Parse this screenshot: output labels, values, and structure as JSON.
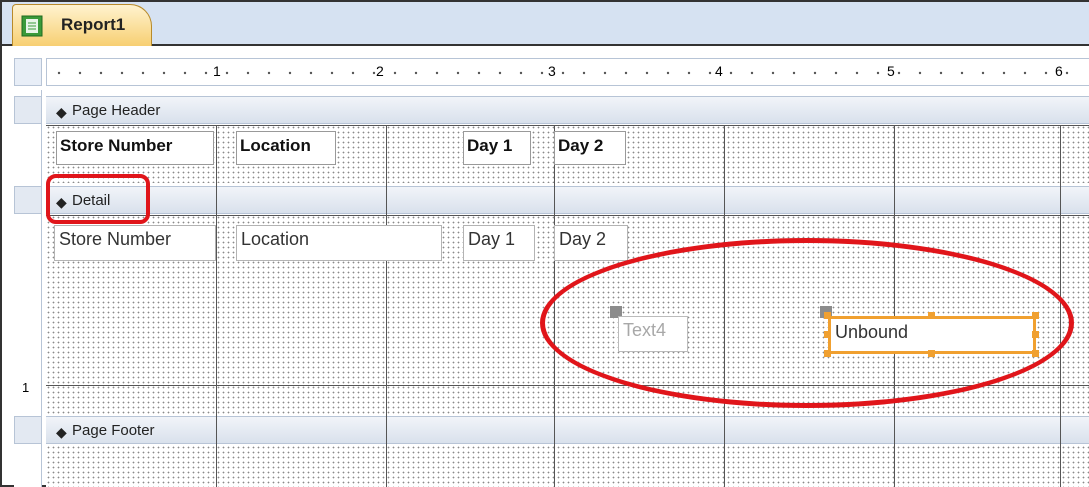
{
  "tab": {
    "title": "Report1",
    "icon": "report-icon"
  },
  "ruler": {
    "marks": [
      "1",
      "2",
      "3",
      "4",
      "5",
      "6"
    ],
    "vertical_mark": "1"
  },
  "sections": {
    "page_header": "Page Header",
    "detail": "Detail",
    "page_footer": "Page Footer"
  },
  "header_labels": {
    "store_number": "Store Number",
    "location": "Location",
    "day1": "Day 1",
    "day2": "Day 2"
  },
  "detail_fields": {
    "store_number": "Store Number",
    "location": "Location",
    "day1": "Day 1",
    "day2": "Day 2",
    "new_label": "Text4",
    "new_textbox": "Unbound"
  },
  "colors": {
    "annotation": "#e0151a",
    "selection": "#f0a030",
    "tab": "#f7cf72"
  }
}
